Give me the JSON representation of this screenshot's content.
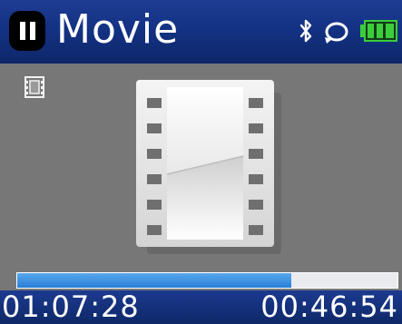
{
  "header": {
    "title": "Movie",
    "play_state_icon": "pause-icon",
    "status_icons": [
      "bluetooth-icon",
      "repeat-icon",
      "battery-icon"
    ]
  },
  "content": {
    "mode_icon": "film-strip-icon",
    "artwork_icon": "film-frame-icon"
  },
  "playback": {
    "progress_fraction": 0.72,
    "elapsed": "01:07:28",
    "remaining": "00:46:54"
  },
  "colors": {
    "header_blue": "#12307f",
    "progress_fill": "#3b8ee0",
    "battery_green": "#3ccd3c",
    "background_gray": "#777777"
  }
}
